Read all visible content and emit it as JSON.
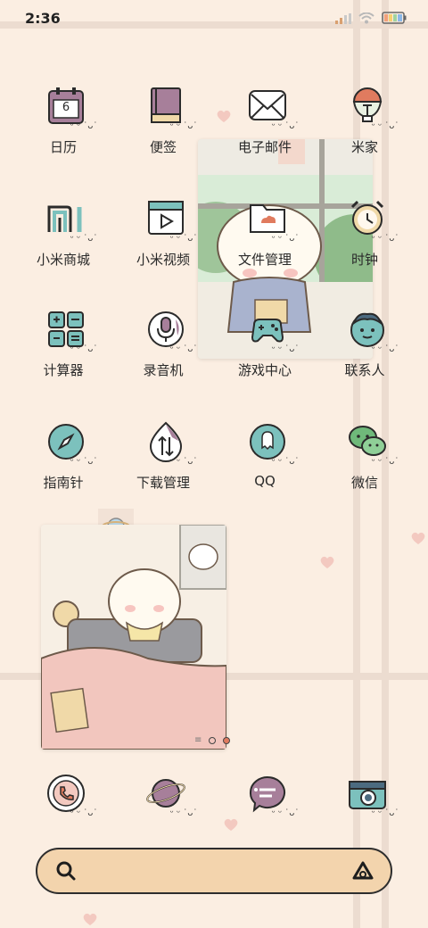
{
  "status": {
    "time": "2:36",
    "icons": [
      "signal-icon",
      "wifi-icon",
      "battery-icon"
    ]
  },
  "apps": {
    "row1": [
      "日历",
      "便签",
      "电子邮件",
      "米家"
    ],
    "row2": [
      "小米商城",
      "小米视频",
      "文件管理",
      "时钟"
    ],
    "row3": [
      "计算器",
      "录音机",
      "游戏中心",
      "联系人"
    ],
    "row4": [
      "指南针",
      "下载管理",
      "QQ",
      "微信"
    ]
  },
  "calendar_day": "6",
  "dock": [
    "phone-icon",
    "browser-icon",
    "messages-icon",
    "camera-icon"
  ],
  "colors": {
    "background": "#fbeee2",
    "grid": "#ecdcd0",
    "searchbar": "#f3d4ad",
    "accent_teal": "#7cc1bd",
    "accent_mauve": "#a77f9a"
  },
  "search": {
    "icon": "search-icon",
    "assistant_icon": "assistant-icon"
  },
  "page_indicator": {
    "pages": 3,
    "active": 2
  }
}
